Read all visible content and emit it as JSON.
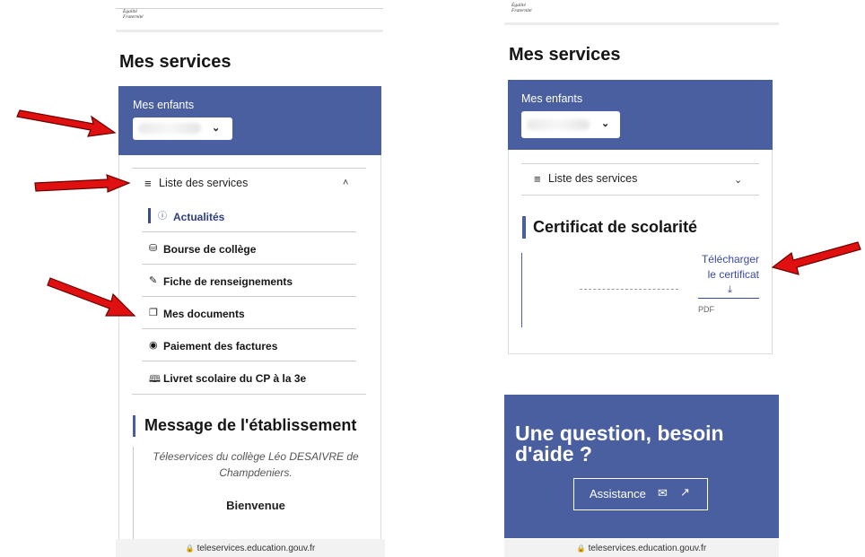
{
  "left": {
    "header_motto": [
      "Égalité",
      "Fraternité"
    ],
    "page_title": "Mes services",
    "children_label": "Mes enfants",
    "services_menu": {
      "label": "Liste des services",
      "icon": "list-icon",
      "state": "expanded",
      "items": [
        {
          "label": "Actualités",
          "icon": "info-icon",
          "active": true
        },
        {
          "label": "Bourse de collège",
          "icon": "coins-icon"
        },
        {
          "label": "Fiche de renseignements",
          "icon": "form-edit-icon"
        },
        {
          "label": "Mes documents",
          "icon": "documents-icon"
        },
        {
          "label": "Paiement des factures",
          "icon": "payment-icon"
        },
        {
          "label": "Livret scolaire du CP à la 3e",
          "icon": "book-icon"
        }
      ]
    },
    "message_section": {
      "title": "Message de l'établissement",
      "line1": "Téleservices du collège Léo DESAIVRE de",
      "line2": "Champdeniers.",
      "welcome": "Bienvenue"
    },
    "url": "teleservices.education.gouv.fr"
  },
  "right": {
    "header_motto": [
      "Égalité",
      "Fraternité"
    ],
    "page_title": "Mes services",
    "children_label": "Mes enfants",
    "services_menu": {
      "label": "Liste des services",
      "icon": "list-icon",
      "state": "collapsed"
    },
    "certificate": {
      "title": "Certificat de scolarité",
      "download_line1": "Télécharger",
      "download_line2": "le certificat",
      "format": "PDF"
    },
    "help": {
      "title_line1": "Une question, besoin",
      "title_line2": "d'aide ?",
      "button_label": "Assistance"
    },
    "url": "teleservices.education.gouv.fr"
  },
  "colors": {
    "brand_blue": "#4a5fa0",
    "link_blue": "#3a4aa0",
    "annotation_arrow": "#e01010"
  }
}
